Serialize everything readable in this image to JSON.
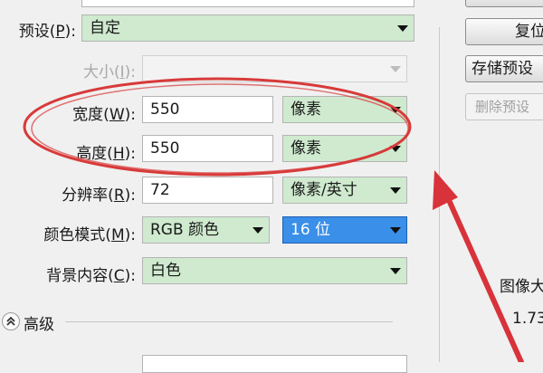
{
  "dialog": {
    "preset": {
      "label": "预设(",
      "key": "P",
      "suffix": "):",
      "value": "自定"
    },
    "size": {
      "label": "大小(",
      "key": "I",
      "suffix": "):"
    },
    "width": {
      "label": "宽度(",
      "key": "W",
      "suffix": "):",
      "value": "550",
      "unit": "像素"
    },
    "height": {
      "label": "高度(",
      "key": "H",
      "suffix": "):",
      "value": "550",
      "unit": "像素"
    },
    "resolution": {
      "label": "分辨率(",
      "key": "R",
      "suffix": "):",
      "value": "72",
      "unit": "像素/英寸"
    },
    "color_mode": {
      "label": "颜色模式(",
      "key": "M",
      "suffix": "):",
      "mode": "RGB 颜色",
      "depth": "16 位"
    },
    "background": {
      "label": "背景内容(",
      "key": "C",
      "suffix": "):",
      "value": "白色"
    },
    "advanced": {
      "label": "高级"
    }
  },
  "buttons": {
    "reset": "复位",
    "save_preset": "存储预设",
    "delete_preset": "删除预设"
  },
  "side_info": {
    "image_size_label": "图像大",
    "image_size_value": "1.73"
  },
  "annotation": {
    "ellipse_color": "#d83a3a",
    "arrow_color": "#d8333a"
  }
}
